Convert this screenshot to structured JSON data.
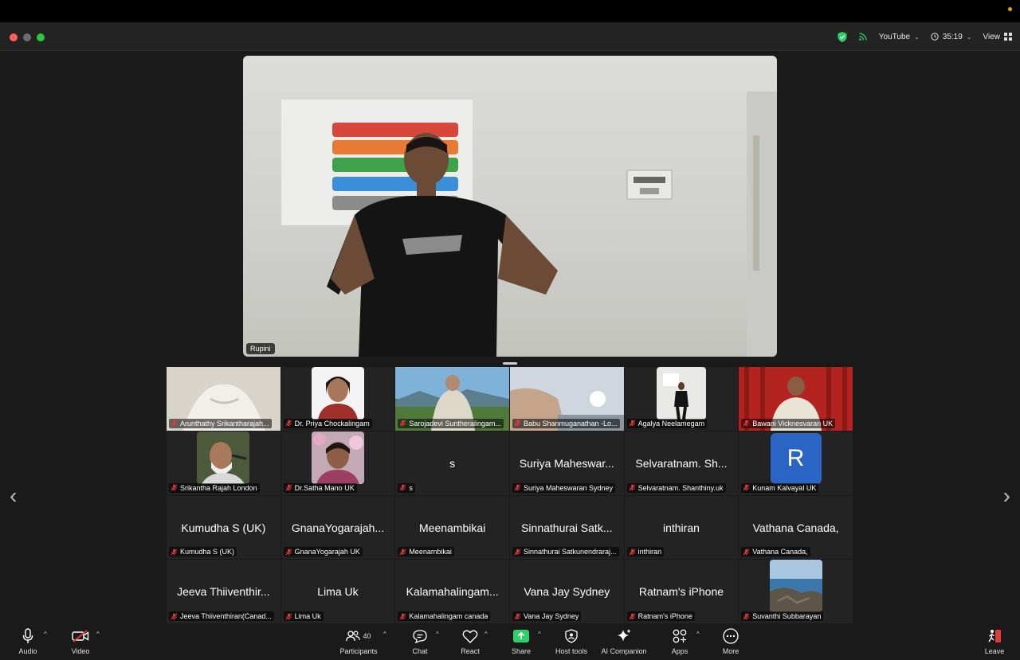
{
  "top_bar": {
    "streaming_label": "YouTube",
    "timer": "35:19",
    "view_label": "View"
  },
  "speaker": {
    "name": "Rupini"
  },
  "gallery": [
    {
      "big": "",
      "label": "Arunthathy Srikantharajah..."
    },
    {
      "big": "",
      "label": "Dr. Priya Chockalingam"
    },
    {
      "big": "",
      "label": "Sarojadevi Suntheralingam..."
    },
    {
      "big": "",
      "label": "Babu Shanmuganathan -Lo..."
    },
    {
      "big": "",
      "label": "Agalya Neelamegam"
    },
    {
      "big": "",
      "label": "Bawani Vicknesvaran UK"
    },
    {
      "big": "",
      "label": "Srikantha Rajah London"
    },
    {
      "big": "",
      "label": "Dr.Satha Mano UK"
    },
    {
      "big": "s",
      "label": "s"
    },
    {
      "big": "Suriya Maheswar...",
      "label": "Suriya Maheswaran Sydney"
    },
    {
      "big": "Selvaratnam. Sh...",
      "label": "Selvaratnam. Shanthiny.uk"
    },
    {
      "big": "",
      "label": "Kunam Kalvayal UK",
      "avatar_letter": "R"
    },
    {
      "big": "Kumudha S (UK)",
      "label": "Kumudha S (UK)"
    },
    {
      "big": "GnanaYogarajah...",
      "label": "GnanaYogarajah UK"
    },
    {
      "big": "Meenambikai",
      "label": "Meenambikai"
    },
    {
      "big": "Sinnathurai Satk...",
      "label": "Sinnathurai Satkunendraraj..."
    },
    {
      "big": "inthiran",
      "label": "inthiran"
    },
    {
      "big": "Vathana Canada,",
      "label": "Vathana Canada,"
    },
    {
      "big": "Jeeva Thiiventhir...",
      "label": "Jeeva Thiiventhiran(Canad..."
    },
    {
      "big": "Lima  Uk",
      "label": "Lima  Uk"
    },
    {
      "big": "Kalamahalingam...",
      "label": "Kalamahalingam canada"
    },
    {
      "big": "Vana Jay Sydney",
      "label": "Vana Jay Sydney"
    },
    {
      "big": "Ratnam's iPhone",
      "label": "Ratnam's iPhone"
    },
    {
      "big": "",
      "label": "Suvanthi Subbarayan"
    }
  ],
  "toolbar": {
    "audio": "Audio",
    "video": "Video",
    "participants": "Participants",
    "participants_count": "40",
    "chat": "Chat",
    "react": "React",
    "share": "Share",
    "host_tools": "Host tools",
    "ai_companion": "AI Companion",
    "apps": "Apps",
    "more": "More",
    "leave": "Leave"
  },
  "colors": {
    "share_green": "#2fcf6b",
    "mute_red": "#e03b3b",
    "avatar_blue": "#2a64c5"
  }
}
